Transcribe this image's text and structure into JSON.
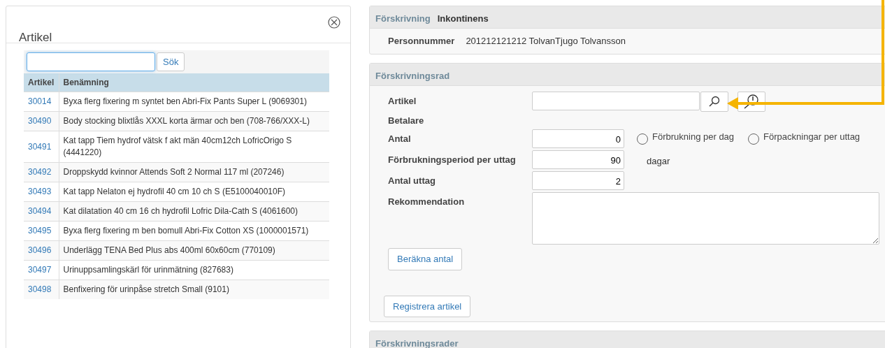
{
  "article_dialog": {
    "title": "Artikel",
    "search": {
      "focused": true,
      "button": "Sök"
    },
    "table": {
      "columns": [
        "Artikel",
        "Benämning"
      ],
      "rows": [
        {
          "article": "30014",
          "name": "Byxa flerg fixering m syntet ben Abri-Fix Pants Super L (9069301)"
        },
        {
          "article": "30490",
          "name": "Body stocking blixtlås XXXL korta ärmar och ben (708-766/XXX-L)"
        },
        {
          "article": "30491",
          "name": "Kat tapp Tiem hydrof vätsk f akt män 40cm12ch LofricOrigo S (4441220)"
        },
        {
          "article": "30492",
          "name": "Droppskydd kvinnor Attends Soft 2 Normal 117 ml (207246)"
        },
        {
          "article": "30493",
          "name": "Kat tapp Nelaton ej hydrofil 40 cm 10 ch S (E5100040010F)"
        },
        {
          "article": "30494",
          "name": "Kat dilatation 40 cm 16 ch hydrofil Lofric Dila-Cath S (4061600)"
        },
        {
          "article": "30495",
          "name": "Byxa flerg fixering m ben bomull Abri-Fix Cotton XS (1000001571)"
        },
        {
          "article": "30496",
          "name": "Underlägg TENA Bed Plus abs 400ml 60x60cm (770109)"
        },
        {
          "article": "30497",
          "name": "Urinuppsamlingskärl för urinmätning (827683)"
        },
        {
          "article": "30498",
          "name": "Benfixering för urinpåse stretch Small (9101)"
        }
      ]
    }
  },
  "prescription": {
    "label": "Förskrivning",
    "value": "Inkontinens",
    "person_label": "Personnummer",
    "person_value": "201212121212 TolvanTjugo Tolvansson"
  },
  "row_form": {
    "title": "Förskrivningsrad",
    "fields": [
      {
        "kind": "lookup",
        "label": "Artikel"
      },
      {
        "kind": "heading",
        "label": "Betalare"
      },
      {
        "kind": "number",
        "label": "Antal",
        "value": "0",
        "options": [
          {
            "label": "Förbrukning per dag",
            "selected": false
          },
          {
            "label": "Förpackningar per uttag",
            "selected": false
          }
        ]
      },
      {
        "kind": "number",
        "label": "Förbrukningsperiod per uttag",
        "value": "90",
        "suffix": "dagar"
      },
      {
        "kind": "number",
        "label": "Antal uttag",
        "value": "2"
      },
      {
        "kind": "textarea",
        "label": "Rekommendation"
      }
    ],
    "calc_button": "Beräkna antal",
    "register_button": "Registrera artikel"
  },
  "rows_section": {
    "title": "Förskrivningsrader"
  }
}
